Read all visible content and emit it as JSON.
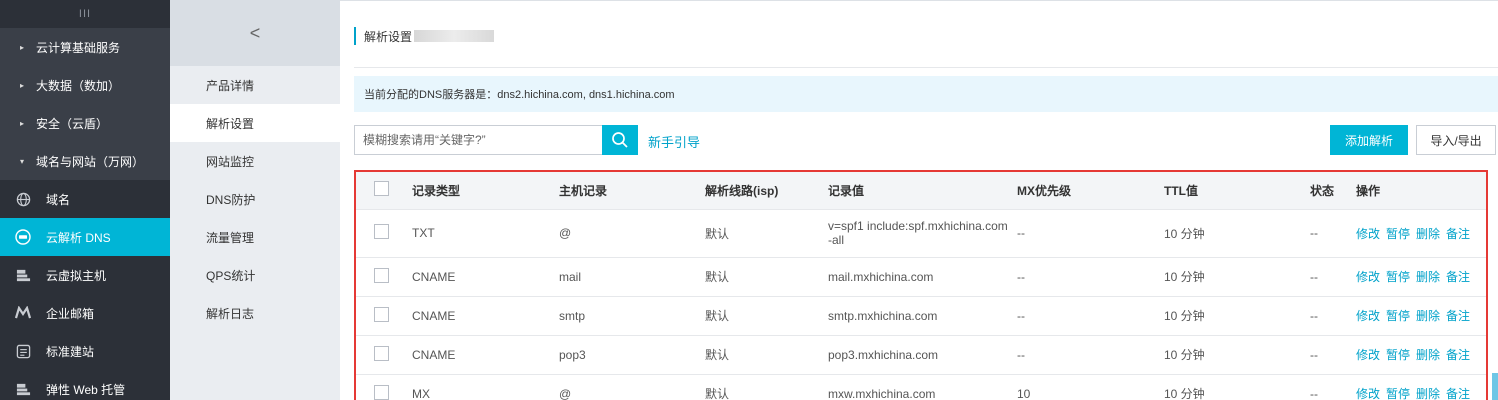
{
  "sidebar": {
    "toggle": "III",
    "groups": [
      {
        "label": "云计算基础服务",
        "caret": "▸"
      },
      {
        "label": "大数据（数加）",
        "caret": "▸"
      },
      {
        "label": "安全（云盾）",
        "caret": "▸"
      },
      {
        "label": "域名与网站（万网）",
        "caret": "▾"
      }
    ],
    "items": [
      {
        "label": "域名",
        "icon": "globe-icon"
      },
      {
        "label": "云解析 DNS",
        "icon": "dns-icon",
        "active": true
      },
      {
        "label": "云虚拟主机",
        "icon": "server-icon"
      },
      {
        "label": "企业邮箱",
        "icon": "mail-m-icon"
      },
      {
        "label": "标准建站",
        "icon": "site-icon"
      },
      {
        "label": "弹性 Web 托管",
        "icon": "server-icon"
      }
    ]
  },
  "subnav": {
    "back_glyph": "<",
    "items": [
      {
        "label": "产品详情"
      },
      {
        "label": "解析设置",
        "active": true
      },
      {
        "label": "网站监控"
      },
      {
        "label": "DNS防护"
      },
      {
        "label": "流量管理"
      },
      {
        "label": "QPS统计"
      },
      {
        "label": "解析日志"
      }
    ]
  },
  "main": {
    "title": "解析设置",
    "notice": "当前分配的DNS服务器是：dns2.hichina.com, dns1.hichina.com",
    "search_placeholder": "模糊搜索请用“关键字?”",
    "guide_link": "新手引导",
    "add_button": "添加解析",
    "import_export_button": "导入/导出",
    "accent_color": "#00b5d6"
  },
  "table": {
    "headers": [
      "记录类型",
      "主机记录",
      "解析线路(isp)",
      "记录值",
      "MX优先级",
      "TTL值",
      "状态",
      "操作"
    ],
    "actions": [
      "修改",
      "暂停",
      "删除",
      "备注"
    ],
    "rows": [
      {
        "type": "TXT",
        "host": "@",
        "line": "默认",
        "value": "v=spf1 include:spf.mxhichina.com -all",
        "mx": "--",
        "ttl": "10 分钟",
        "status": "--"
      },
      {
        "type": "CNAME",
        "host": "mail",
        "line": "默认",
        "value": "mail.mxhichina.com",
        "mx": "--",
        "ttl": "10 分钟",
        "status": "--"
      },
      {
        "type": "CNAME",
        "host": "smtp",
        "line": "默认",
        "value": "smtp.mxhichina.com",
        "mx": "--",
        "ttl": "10 分钟",
        "status": "--"
      },
      {
        "type": "CNAME",
        "host": "pop3",
        "line": "默认",
        "value": "pop3.mxhichina.com",
        "mx": "--",
        "ttl": "10 分钟",
        "status": "--"
      },
      {
        "type": "MX",
        "host": "@",
        "line": "默认",
        "value": "mxw.mxhichina.com",
        "mx": "10",
        "ttl": "10 分钟",
        "status": "--"
      }
    ]
  }
}
